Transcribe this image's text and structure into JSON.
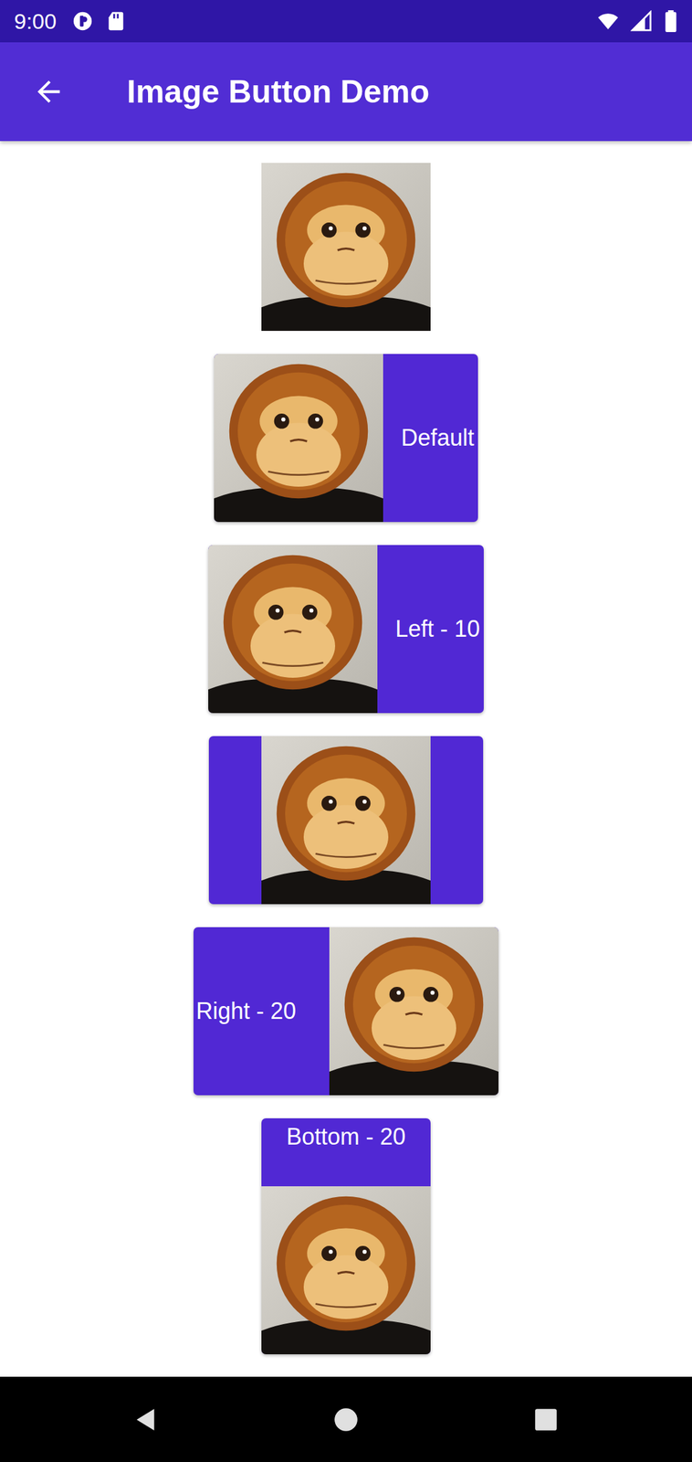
{
  "status_bar": {
    "time": "9:00"
  },
  "app_bar": {
    "title": "Image Button Demo"
  },
  "buttons": [
    {
      "kind": "image"
    },
    {
      "kind": "image-left",
      "label": "Default"
    },
    {
      "kind": "image-left",
      "label": "Left - 10"
    },
    {
      "kind": "image-center"
    },
    {
      "kind": "image-right",
      "label": "Right - 20"
    },
    {
      "kind": "image-bottom",
      "label": "Bottom - 20"
    }
  ]
}
